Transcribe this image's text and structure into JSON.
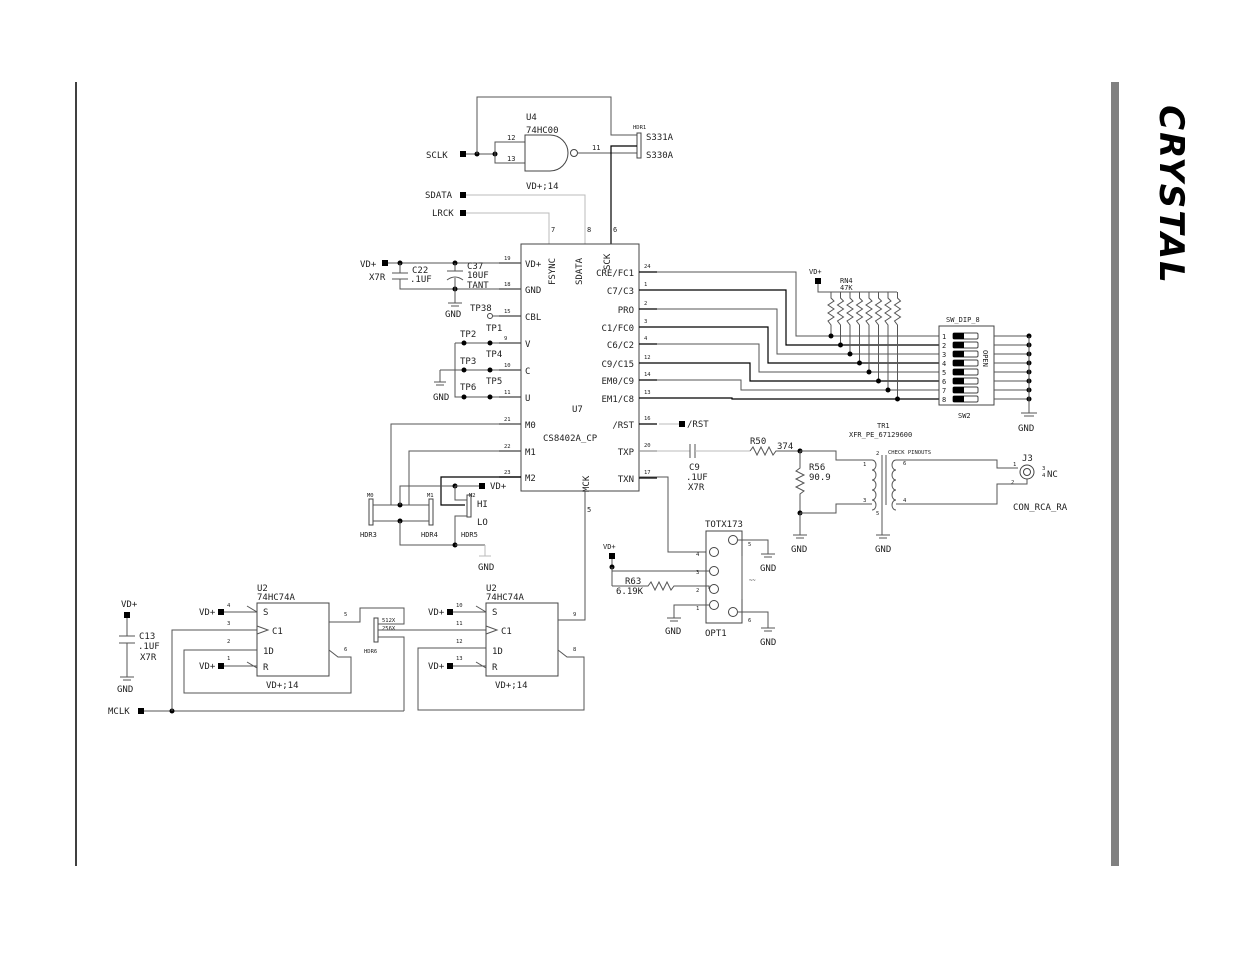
{
  "title_block": {
    "logo_text": "CRYSTAL",
    "logo_orientation": "rotated-90",
    "side_bar_color": "#808080",
    "left_border_color": "#000000"
  },
  "nets": {
    "sclk": "SCLK",
    "sdata": "SDATA",
    "lrck": "LRCK",
    "mclk": "MCLK",
    "vdplus": "VD+",
    "gnd": "GND",
    "rst": "/RST"
  },
  "u4": {
    "ref": "U4",
    "part": "74HC00",
    "power": "VD+;14",
    "pins": {
      "in_a": "12",
      "in_b": "13",
      "out": "11"
    }
  },
  "hdr1": {
    "ref": "HDR1",
    "options": [
      "S331A",
      "S330A"
    ]
  },
  "u7": {
    "ref": "U7",
    "part": "CS8402A_CP",
    "left_pins": [
      {
        "num": "19",
        "name": "VD+"
      },
      {
        "num": "18",
        "name": "GND"
      },
      {
        "num": "15",
        "name": "CBL"
      },
      {
        "num": "9",
        "name": "V"
      },
      {
        "num": "10",
        "name": "C"
      },
      {
        "num": "11",
        "name": "U"
      },
      {
        "num": "21",
        "name": "M0"
      },
      {
        "num": "22",
        "name": "M1"
      },
      {
        "num": "23",
        "name": "M2"
      }
    ],
    "top_pins": [
      {
        "num": "7",
        "name": "FSYNC"
      },
      {
        "num": "8",
        "name": "SDATA"
      },
      {
        "num": "6",
        "name": "SCK"
      }
    ],
    "bottom_pins": [
      {
        "num": "5",
        "name": "MCK"
      }
    ],
    "right_pins": [
      {
        "num": "24",
        "name": "CRE/FC1"
      },
      {
        "num": "1",
        "name": "C7/C3"
      },
      {
        "num": "2",
        "name": "PRO"
      },
      {
        "num": "3",
        "name": "C1/FC0"
      },
      {
        "num": "4",
        "name": "C6/C2"
      },
      {
        "num": "12",
        "name": "C9/C15"
      },
      {
        "num": "14",
        "name": "EM0/C9"
      },
      {
        "num": "13",
        "name": "EM1/C8"
      },
      {
        "num": "16",
        "name": "/RST"
      },
      {
        "num": "20",
        "name": "TXP"
      },
      {
        "num": "17",
        "name": "TXN"
      }
    ]
  },
  "c22": {
    "ref": "C22",
    "value": ".1UF",
    "type": "X7R"
  },
  "c37": {
    "ref": "C37",
    "value": "10UF",
    "type": "TANT"
  },
  "c9": {
    "ref": "C9",
    "value": ".1UF",
    "type": "X7R"
  },
  "c13": {
    "ref": "C13",
    "value": ".1UF",
    "type": "X7R"
  },
  "testpoints": [
    "TP38",
    "TP1",
    "TP2",
    "TP3",
    "TP4",
    "TP5",
    "TP6"
  ],
  "rn4": {
    "ref": "RN4",
    "value": "47K"
  },
  "sw2": {
    "ref": "SW2",
    "part": "SW_DIP_8",
    "open_label": "OPEN",
    "positions": [
      "1",
      "2",
      "3",
      "4",
      "5",
      "6",
      "7",
      "8"
    ]
  },
  "r50": {
    "ref": "R50",
    "value": "374"
  },
  "r56": {
    "ref": "R56",
    "value": "90.9"
  },
  "r63": {
    "ref": "R63",
    "value": "6.19K"
  },
  "tr1": {
    "ref": "TR1",
    "part": "XFR_PE_67129600",
    "note": "CHECK PINOUTS",
    "pins": {
      "p1": "1",
      "p2": "2",
      "p3": "3",
      "p4": "4",
      "p5": "5",
      "p6": "6"
    }
  },
  "j3": {
    "ref": "J3",
    "part": "CON_RCA_RA",
    "pins": {
      "p1": "1",
      "p2": "2"
    },
    "nc_pins": "3\n4",
    "nc_label": "NC"
  },
  "opt1": {
    "ref": "OPT1",
    "part": "TOTX173",
    "pins": [
      "4",
      "3",
      "2",
      "1",
      "5",
      "6"
    ]
  },
  "headers": {
    "hdr3": {
      "ref": "HDR3",
      "label": "M0"
    },
    "hdr4": {
      "ref": "HDR4",
      "label": "M1"
    },
    "hdr5": {
      "ref": "HDR5",
      "label": "M2",
      "options": [
        "HI",
        "LO"
      ]
    },
    "hdr6": {
      "ref": "HDR6",
      "options": [
        "512X",
        "256X"
      ]
    }
  },
  "u2a": {
    "ref": "U2",
    "part": "74HC74A",
    "power": "VD+;14",
    "pins": {
      "S": "4",
      "C1": "3",
      "1D": "2",
      "R": "1",
      "Q": "5",
      "Qn": "6"
    },
    "pin_names": {
      "S": "S",
      "C1": "C1",
      "D": "1D",
      "R": "R"
    }
  },
  "u2b": {
    "ref": "U2",
    "part": "74HC74A",
    "power": "VD+;14",
    "pins": {
      "S": "10",
      "C1": "11",
      "1D": "12",
      "R": "13",
      "Q": "9",
      "Qn": "8"
    },
    "pin_names": {
      "S": "S",
      "C1": "C1",
      "D": "1D",
      "R": "R"
    }
  }
}
